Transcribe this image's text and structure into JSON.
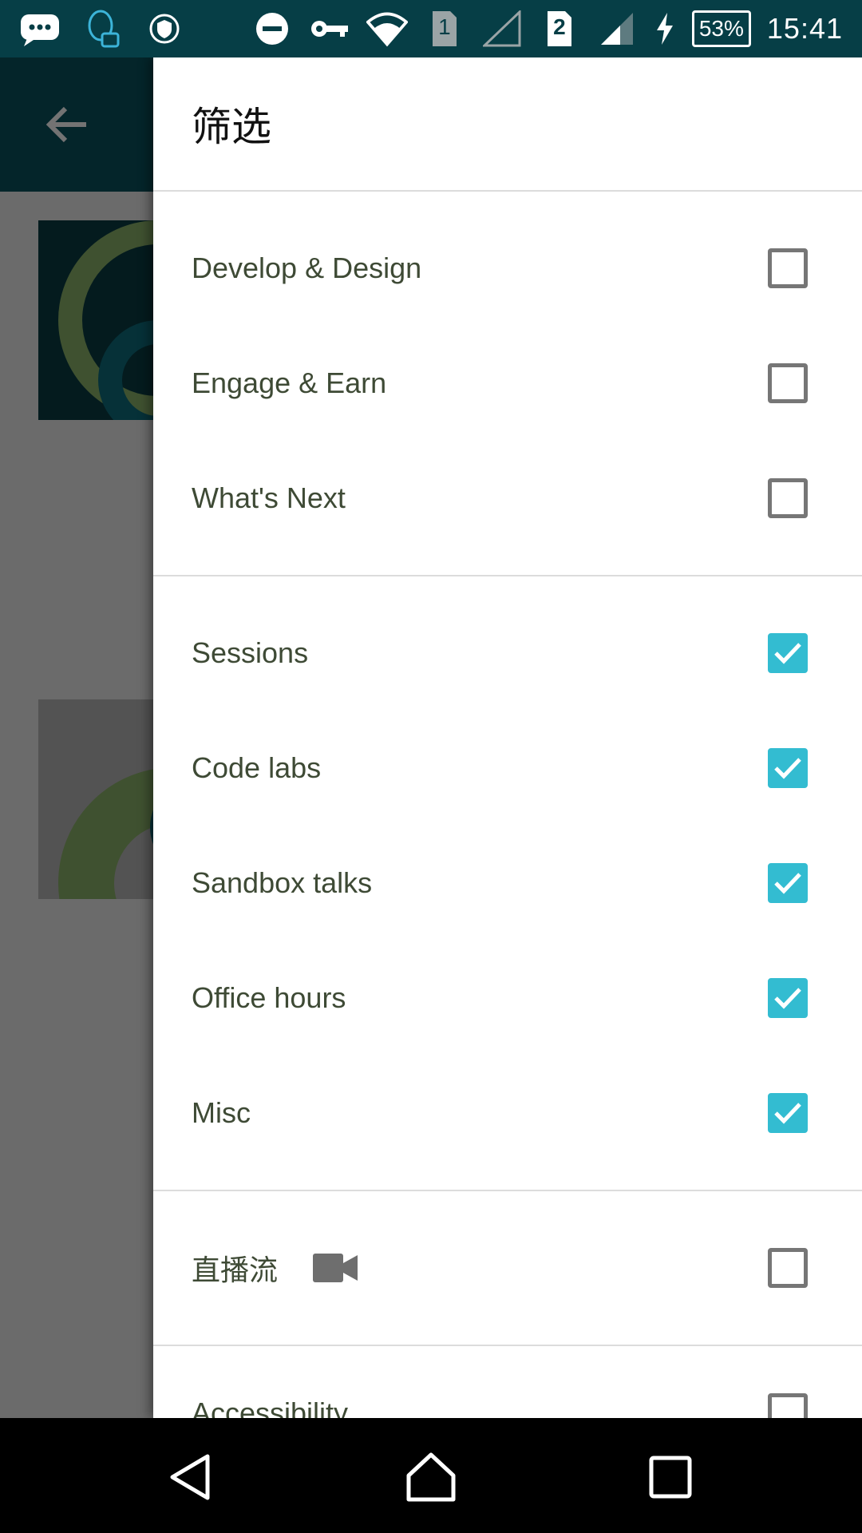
{
  "status_bar": {
    "time": "15:41",
    "battery_percent": "53%",
    "sim1_label": "1",
    "sim2_label": "2",
    "left_icons": [
      "chat-bubble-icon",
      "qq-icon",
      "shield-icon"
    ],
    "right_icons": [
      "do-not-disturb-icon",
      "vpn-key-icon",
      "wifi-icon",
      "sim-1-icon",
      "signal-empty-icon",
      "sim-2-icon",
      "signal-icon",
      "charging-icon",
      "battery-icon"
    ]
  },
  "colors": {
    "accent": "#33bcd1",
    "status_bar": "#063e46",
    "app_bar": "#0b525d",
    "label_text": "#3e4a35"
  },
  "drawer": {
    "title": "筛选",
    "groups": [
      {
        "items": [
          {
            "label": "Develop & Design",
            "checked": false
          },
          {
            "label": "Engage & Earn",
            "checked": false
          },
          {
            "label": "What's Next",
            "checked": false
          }
        ]
      },
      {
        "items": [
          {
            "label": "Sessions",
            "checked": true
          },
          {
            "label": "Code labs",
            "checked": true
          },
          {
            "label": "Sandbox talks",
            "checked": true
          },
          {
            "label": "Office hours",
            "checked": true
          },
          {
            "label": "Misc",
            "checked": true
          }
        ]
      },
      {
        "items": [
          {
            "label": "直播流",
            "checked": false,
            "icon": "video-camera-icon"
          }
        ]
      },
      {
        "items": [
          {
            "label": "Accessibility",
            "checked": false
          }
        ]
      }
    ]
  },
  "nav_bar": {
    "buttons": [
      "back-icon",
      "home-icon",
      "recents-icon"
    ]
  }
}
